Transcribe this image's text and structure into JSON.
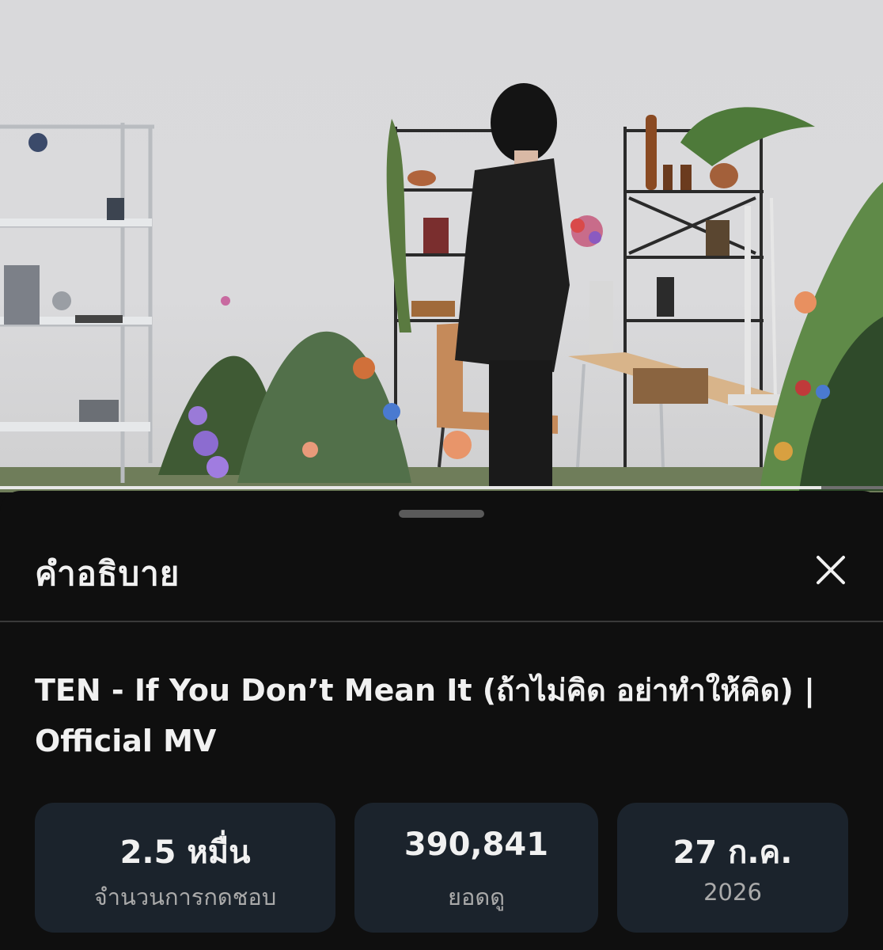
{
  "video": {
    "thumbnail_description_icon": "music-video-still",
    "progress_fraction": 0.93
  },
  "sheet": {
    "title": "คำอธิบาย",
    "close_icon": "close-icon"
  },
  "video_info": {
    "title": "TEN - If You Don’t Mean It (ถ้าไม่คิด อย่าทำให้คิด) | Official MV",
    "likes_value": "2.5 หมื่น",
    "likes_label": "จำนวนการกดชอบ",
    "views_value": "390,841",
    "views_label": "ยอดดู",
    "date_value": "27 ก.ค.",
    "date_year": "2026"
  },
  "colors": {
    "background": "#0f0f0f",
    "stat_card": "#1b232c",
    "text_primary": "#f1f1f1",
    "text_secondary": "#aaaaaa"
  }
}
